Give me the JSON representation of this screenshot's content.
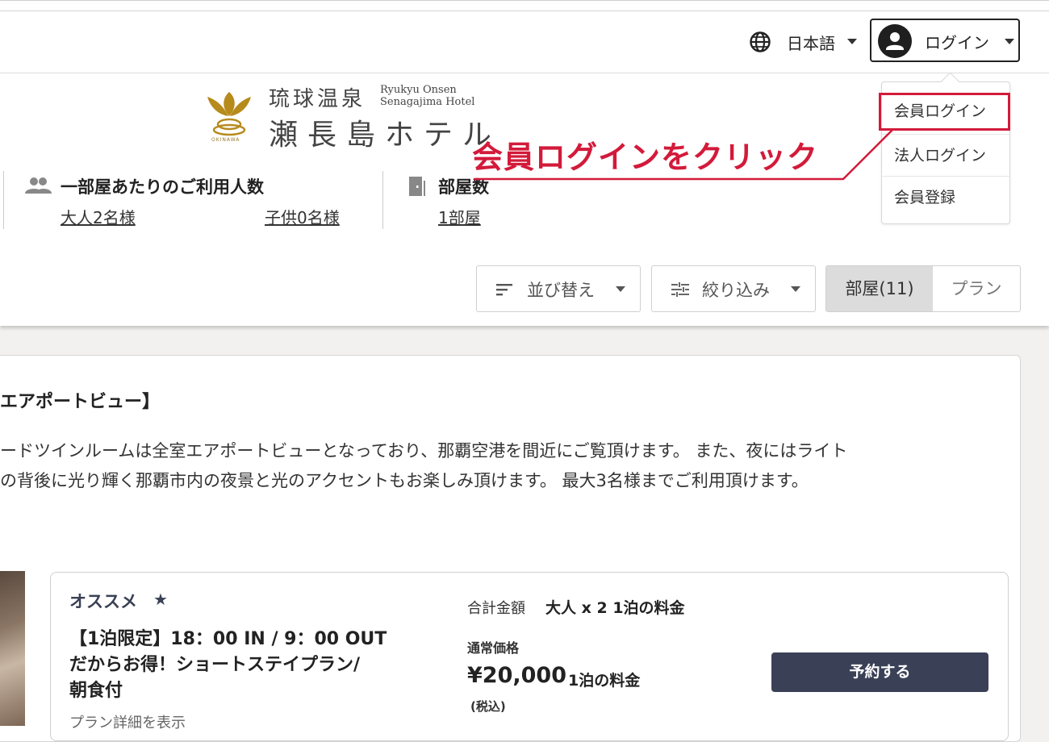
{
  "header": {
    "language": {
      "label": "日本語",
      "icon": "globe-icon"
    },
    "login": {
      "label": "ログイン",
      "icon": "user-avatar-icon"
    },
    "logo": {
      "name_top": "琉球温泉",
      "name_main": "瀬長島ホテル",
      "name_en_line1": "Ryukyu Onsen",
      "name_en_line2": "Senagajima Hotel",
      "okinawa": "OKINAWA"
    },
    "guests": {
      "icon": "people-icon",
      "title": "一部屋あたりのご利用人数",
      "adults": "大人2名様",
      "children": "子供0名様"
    },
    "rooms": {
      "icon": "door-icon",
      "title": "部屋数",
      "count": "1部屋"
    }
  },
  "login_menu": {
    "items": [
      {
        "label": "会員ログイン"
      },
      {
        "label": "法人ログイン"
      },
      {
        "label": "会員登録"
      }
    ],
    "highlight_color": "#d31a3a"
  },
  "annotation": {
    "text": "会員ログインをクリック",
    "color": "#d31a3a"
  },
  "toolbar": {
    "sort": {
      "label": "並び替え",
      "icon": "sort-icon"
    },
    "filter": {
      "label": "絞り込み",
      "icon": "filter-sliders-icon"
    },
    "tabs": [
      {
        "label": "部屋(11)",
        "selected": true
      },
      {
        "label": "プラン",
        "selected": false
      }
    ]
  },
  "room": {
    "title": "エアポートビュー】",
    "description_line1": "ードツインルームは全室エアポートビューとなっており、那覇空港を間近にご覧頂けます。 また、夜にはライト",
    "description_line2": "の背後に光り輝く那覇市内の夜景と光のアクセントもお楽しみ頂けます。 最大3名様までご利用頂けます。"
  },
  "plan": {
    "badge": "オススメ",
    "badge_icon": "★",
    "name_line1": "【1泊限定】18：00 IN / 9：00 OUT",
    "name_line2": "だからお得！ショートステイプラン/",
    "name_line3": "朝食付",
    "detail_link": "プラン詳細を表示",
    "total_label": "合計金額",
    "total_value": "大人 x 2 1泊の料金",
    "regular_label": "通常価格",
    "price": "¥20,000",
    "price_unit": "1泊の料金",
    "tax_note": "(税込)",
    "reserve_label": "予約する",
    "reserve_color": "#3a4157"
  }
}
